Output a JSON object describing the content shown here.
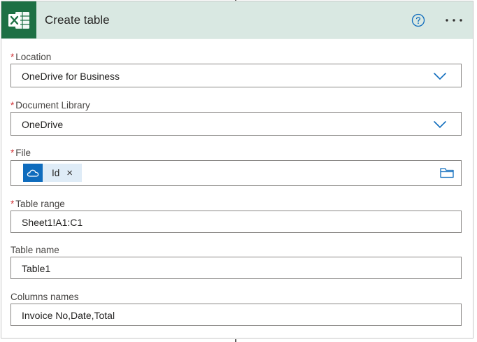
{
  "header": {
    "title": "Create table",
    "app_icon": "excel-icon",
    "help_icon": "help-circle-icon",
    "more_icon": "more-ellipsis-icon",
    "brand_color": "#1d7044",
    "header_bg": "#d9e8e2"
  },
  "fields": {
    "location": {
      "label": "Location",
      "required": "*",
      "value": "OneDrive for Business",
      "icon": "chevron-down-icon"
    },
    "document_library": {
      "label": "Document Library",
      "required": "*",
      "value": "OneDrive",
      "icon": "chevron-down-icon"
    },
    "file": {
      "label": "File",
      "required": "*",
      "token_label": "Id",
      "token_remove": "×",
      "token_icon": "onedrive-icon",
      "picker_icon": "folder-icon"
    },
    "table_range": {
      "label": "Table range",
      "required": "*",
      "value": "Sheet1!A1:C1"
    },
    "table_name": {
      "label": "Table name",
      "value": "Table1"
    },
    "columns_names": {
      "label": "Columns names",
      "value": "Invoice No,Date,Total"
    }
  },
  "colors": {
    "required": "#d13438",
    "accent": "#0f6cbd",
    "token_bg": "#dfecf7"
  }
}
